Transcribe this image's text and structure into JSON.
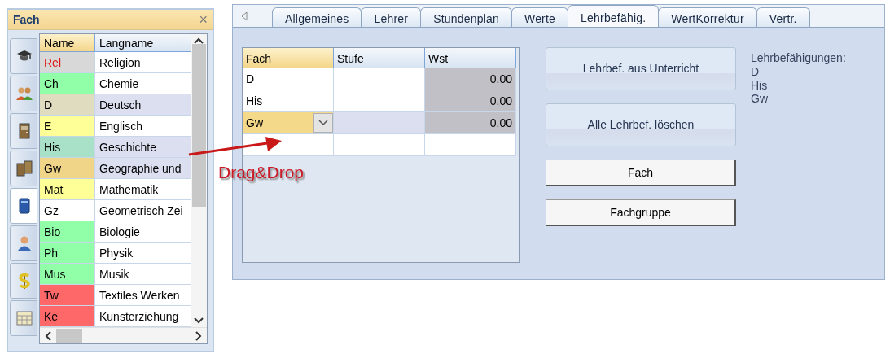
{
  "fach_panel": {
    "title": "Fach",
    "close": "×",
    "sidebar": {
      "items": [
        {
          "selected": false
        },
        {
          "selected": false
        },
        {
          "selected": false
        },
        {
          "selected": false
        },
        {
          "selected": true
        },
        {
          "selected": false
        },
        {
          "selected": false
        },
        {
          "selected": false
        }
      ]
    },
    "columns": [
      {
        "label": "Name",
        "selected": true
      },
      {
        "label": "Langname",
        "selected": false
      }
    ],
    "rows": [
      {
        "name": "Rel",
        "langname": "Religion",
        "color": "#d8d8d8",
        "highlighted": true,
        "selected": false
      },
      {
        "name": "Ch",
        "langname": "Chemie",
        "color": "#90ffa8",
        "highlighted": false,
        "selected": false
      },
      {
        "name": "D",
        "langname": "Deutsch",
        "color": "#e0dcc0",
        "highlighted": false,
        "selected": true
      },
      {
        "name": "E",
        "langname": "Englisch",
        "color": "#ffff98",
        "highlighted": false,
        "selected": false
      },
      {
        "name": "His",
        "langname": "Geschichte",
        "color": "#a8e0c8",
        "highlighted": false,
        "selected": true
      },
      {
        "name": "Gw",
        "langname": "Geographie und",
        "color": "#f0d488",
        "highlighted": false,
        "selected": true
      },
      {
        "name": "Mat",
        "langname": "Mathematik",
        "color": "#ffff98",
        "highlighted": false,
        "selected": false
      },
      {
        "name": "Gz",
        "langname": "Geometrisch Zei",
        "color": "#ffffff",
        "highlighted": false,
        "selected": false
      },
      {
        "name": "Bio",
        "langname": "Biologie",
        "color": "#90ffa8",
        "highlighted": false,
        "selected": false
      },
      {
        "name": "Ph",
        "langname": "Physik",
        "color": "#90ffa8",
        "highlighted": false,
        "selected": false
      },
      {
        "name": "Mus",
        "langname": "Musik",
        "color": "#90ffa8",
        "highlighted": false,
        "selected": false
      },
      {
        "name": "Tw",
        "langname": "Textiles Werken",
        "color": "#ff6868",
        "highlighted": false,
        "selected": false
      },
      {
        "name": "Ke",
        "langname": "Kunsterziehung",
        "color": "#ff6868",
        "highlighted": false,
        "selected": false
      }
    ]
  },
  "annotation": {
    "label": "Drag&Drop"
  },
  "detail_panel": {
    "tabs": [
      {
        "label": "Allgemeines",
        "selected": false
      },
      {
        "label": "Lehrer",
        "selected": false
      },
      {
        "label": "Stundenplan",
        "selected": false
      },
      {
        "label": "Werte",
        "selected": false
      },
      {
        "label": "Lehrbefähig.",
        "selected": true
      },
      {
        "label": "WertKorrektur",
        "selected": false
      },
      {
        "label": "Vertr.",
        "selected": false
      }
    ],
    "columns": [
      {
        "label": "Fach",
        "selected": true
      },
      {
        "label": "Stufe",
        "selected": false
      },
      {
        "label": "Wst",
        "selected": false
      }
    ],
    "rows": [
      {
        "fach": "D",
        "wst": "0.00",
        "selected": false
      },
      {
        "fach": "His",
        "wst": "0.00",
        "selected": false
      },
      {
        "fach": "Gw",
        "wst": "0.00",
        "selected": true
      }
    ],
    "buttons": [
      {
        "label": "Lehrbef. aus Unterricht",
        "kind": "large"
      },
      {
        "label": "Alle Lehrbef. löschen",
        "kind": "large"
      },
      {
        "label": "Fach",
        "kind": "small"
      },
      {
        "label": "Fachgruppe",
        "kind": "small"
      }
    ],
    "summary": {
      "title": "Lehrbefähigungen:",
      "items": [
        "D",
        "His",
        "Gw"
      ]
    }
  }
}
